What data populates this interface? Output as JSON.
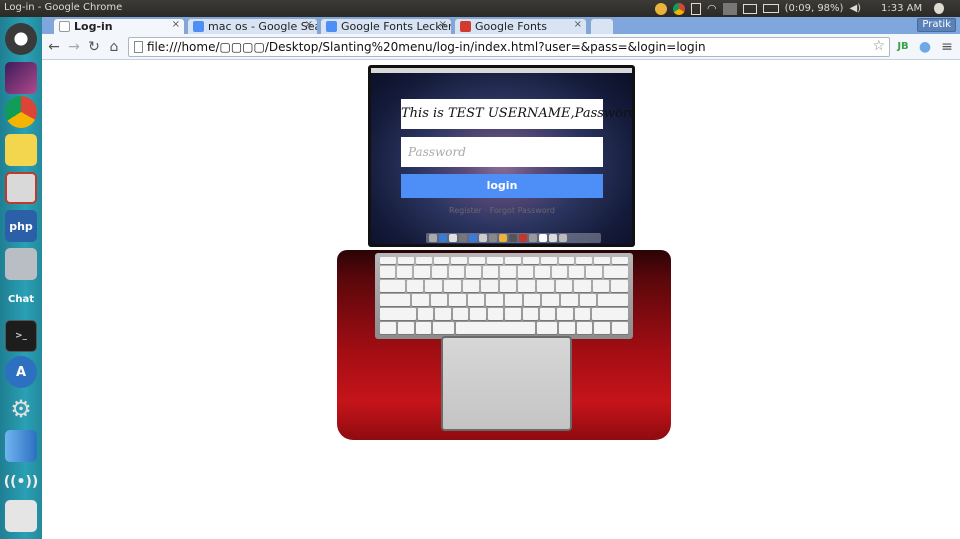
{
  "top_panel": {
    "window_title": "Log-in - Google Chrome",
    "battery": "(0:09, 98%)",
    "time": "1:33 AM"
  },
  "launcher": {
    "items": [
      {
        "name": "ubuntu-dash-icon",
        "color": "#333333"
      },
      {
        "name": "workspace-icon",
        "color": "#6b3a7a"
      },
      {
        "name": "chrome-icon",
        "color": "#ffffff"
      },
      {
        "name": "sticky-notes-icon",
        "color": "#f3d64e"
      },
      {
        "name": "app-icon",
        "color": "#c0392b"
      },
      {
        "name": "php-icon",
        "color": "#2b5fa8",
        "label": "php"
      },
      {
        "name": "disk-icon",
        "color": "#9aa0a6"
      },
      {
        "name": "chat-icon",
        "color": "#2a8fa3",
        "label": "Chat"
      },
      {
        "name": "terminal-icon",
        "color": "#222222"
      },
      {
        "name": "software-center-icon",
        "color": "#2d6fc0"
      },
      {
        "name": "settings-icon",
        "color": "#888888"
      },
      {
        "name": "finder-icon",
        "color": "#3a7bd5"
      },
      {
        "name": "network-icon",
        "color": "#aaaaaa"
      },
      {
        "name": "trash-icon",
        "color": "#dddddd"
      }
    ]
  },
  "browser": {
    "tabs": [
      {
        "label": "Log-in",
        "active": true,
        "favicon_color": "#ffffff"
      },
      {
        "label": "mac os - Google Sear",
        "active": false,
        "favicon_color": "#4e8ef7"
      },
      {
        "label": "Google Fonts Lecker",
        "active": false,
        "favicon_color": "#4e8ef7"
      },
      {
        "label": "Google Fonts",
        "active": false,
        "favicon_color": "#d23a2f"
      }
    ],
    "tab_close": "×",
    "profile_name": "Pratik",
    "nav": {
      "back": "←",
      "forward": "→",
      "reload": "↻",
      "home": "⌂"
    },
    "url": "file:///home/▢▢▢▢/Desktop/Slanting%20menu/log-in/index.html?user=&pass=&login=login",
    "extensions": [
      "JB",
      "●",
      "≡"
    ]
  },
  "login": {
    "title": "This is TEST  USERNAME,Password!",
    "password_placeholder": "Password",
    "button_label": "login",
    "links": "Register · Forgot Password"
  },
  "colors": {
    "accent": "#4e8ef7",
    "laptop_red": "#c5141a",
    "tabstrip": "#7fa7dd"
  }
}
